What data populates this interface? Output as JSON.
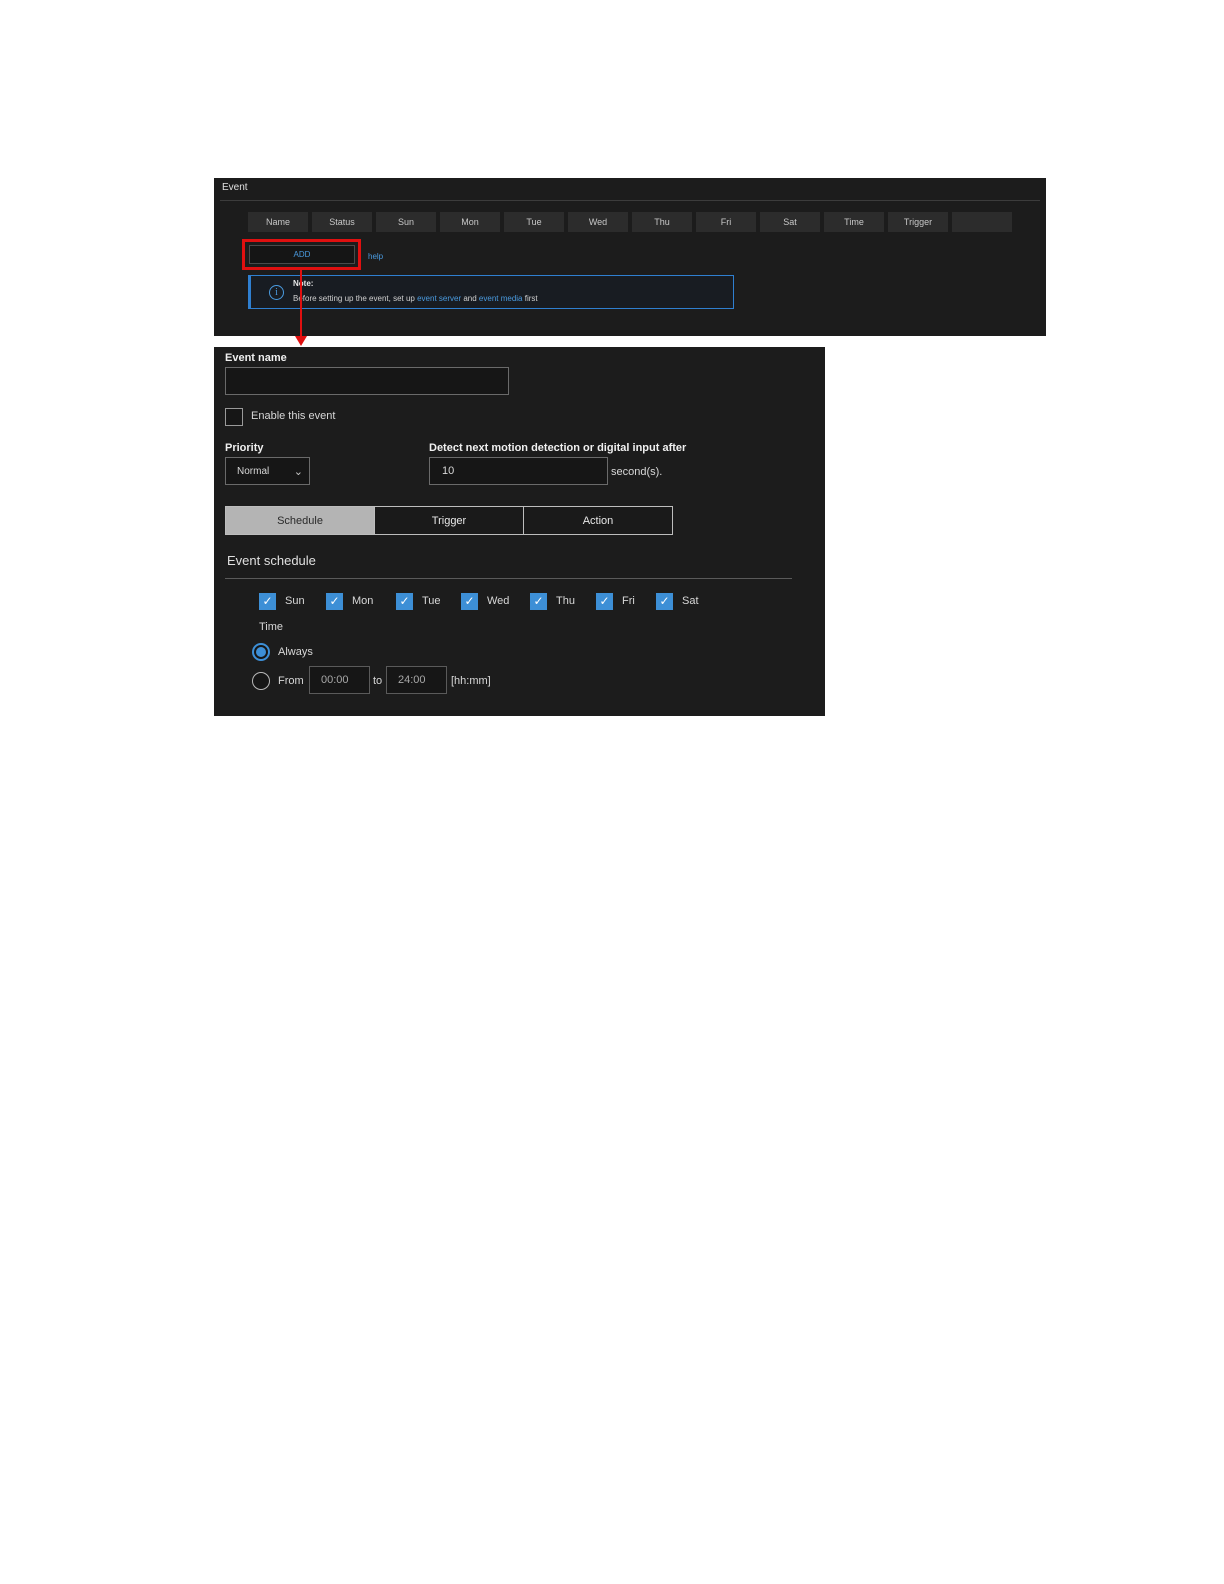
{
  "event_list": {
    "title": "Event",
    "columns": [
      "Name",
      "Status",
      "Sun",
      "Mon",
      "Tue",
      "Wed",
      "Thu",
      "Fri",
      "Sat",
      "Time",
      "Trigger",
      ""
    ],
    "add_label": "ADD",
    "help_label": "help",
    "note": {
      "title": "Note:",
      "text_before": "Before setting up the event, set up ",
      "link_server": "event server",
      "text_and": " and ",
      "link_media": "event media",
      "text_after": " first",
      "icon": "info-icon"
    }
  },
  "form": {
    "event_name_label": "Event name",
    "event_name_value": "",
    "enable_label": "Enable this event",
    "enable_checked": false,
    "priority_label": "Priority",
    "priority_value": "Normal",
    "detect_label": "Detect next motion detection or digital input after",
    "detect_value": "10",
    "seconds_label": "second(s).",
    "tabs": [
      "Schedule",
      "Trigger",
      "Action"
    ],
    "active_tab": "Schedule",
    "schedule_title": "Event schedule",
    "days": [
      "Sun",
      "Mon",
      "Tue",
      "Wed",
      "Thu",
      "Fri",
      "Sat"
    ],
    "days_checked": [
      true,
      true,
      true,
      true,
      true,
      true,
      true
    ],
    "time_label": "Time",
    "always_label": "Always",
    "from_label": "From",
    "from_value": "00:00",
    "to_label": "to",
    "to_value": "24:00",
    "format_label": "[hh:mm]",
    "time_mode": "Always"
  },
  "colors": {
    "panel_bg": "#1c1c1c",
    "accent_blue": "#3d8fd6",
    "link_blue": "#4a9be0",
    "highlight_red": "#e01010"
  }
}
